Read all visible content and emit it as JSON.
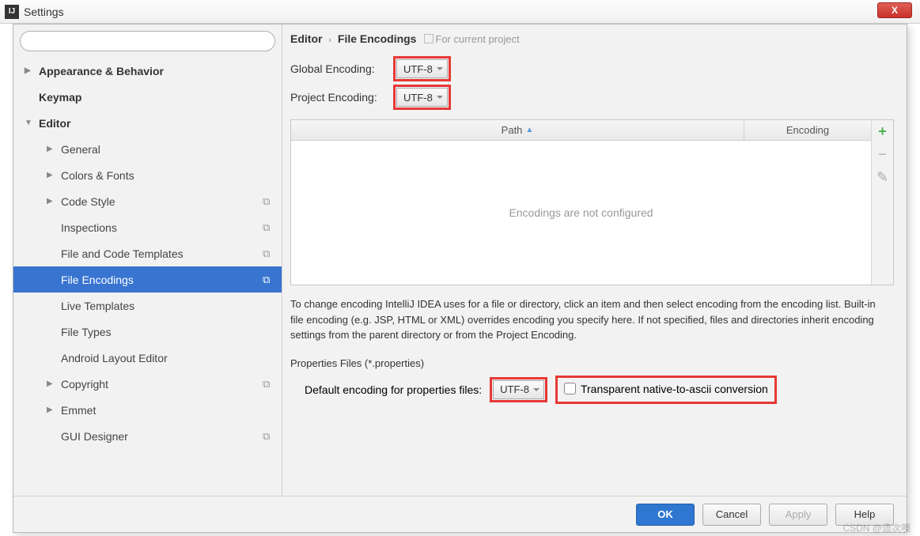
{
  "window": {
    "title": "Settings",
    "close": "X"
  },
  "search": {
    "placeholder": ""
  },
  "tree": {
    "appearance": "Appearance & Behavior",
    "keymap": "Keymap",
    "editor": "Editor",
    "general": "General",
    "colors": "Colors & Fonts",
    "codestyle": "Code Style",
    "inspections": "Inspections",
    "templates": "File and Code Templates",
    "encodings": "File Encodings",
    "live": "Live Templates",
    "filetypes": "File Types",
    "android": "Android Layout Editor",
    "copyright": "Copyright",
    "emmet": "Emmet",
    "gui": "GUI Designer"
  },
  "main": {
    "crumb_editor": "Editor",
    "crumb_page": "File Encodings",
    "scope": "For current project",
    "global_label": "Global Encoding:",
    "global_value": "UTF-8",
    "project_label": "Project Encoding:",
    "project_value": "UTF-8",
    "col_path": "Path",
    "col_enc": "Encoding",
    "empty": "Encodings are not configured",
    "help": "To change encoding IntelliJ IDEA uses for a file or directory, click an item and then select encoding from the encoding list. Built-in file encoding (e.g. JSP, HTML or XML) overrides encoding you specify here. If not specified, files and directories inherit encoding settings from the parent directory or from the Project Encoding.",
    "props_section": "Properties Files (*.properties)",
    "props_label": "Default encoding for properties files:",
    "props_value": "UTF-8",
    "transparent": "Transparent native-to-ascii conversion"
  },
  "buttons": {
    "ok": "OK",
    "cancel": "Cancel",
    "apply": "Apply",
    "help": "Help"
  },
  "watermark": "CSDN @造次噢"
}
